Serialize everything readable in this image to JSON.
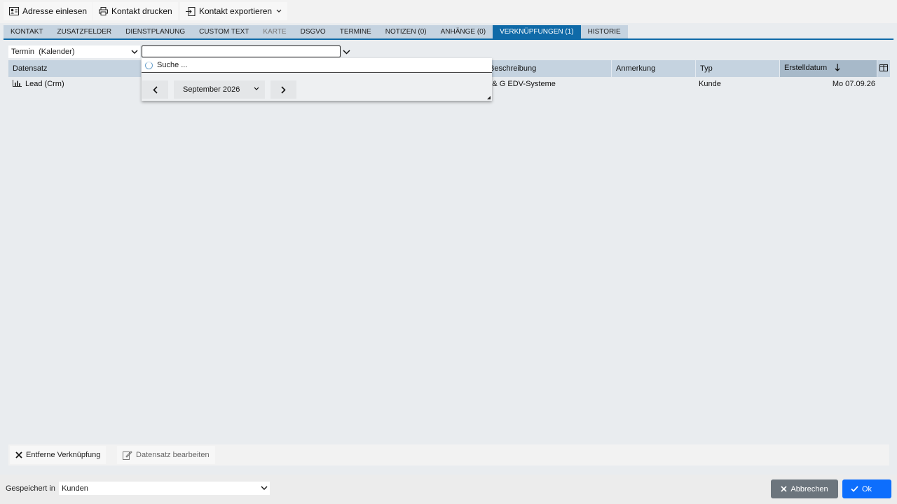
{
  "toolbar": {
    "read_address": "Adresse einlesen",
    "print_contact": "Kontakt drucken",
    "export_contact": "Kontakt exportieren"
  },
  "tabs": [
    {
      "label": "KONTAKT",
      "state": "normal"
    },
    {
      "label": "ZUSATZFELDER",
      "state": "normal"
    },
    {
      "label": "DIENSTPLANUNG",
      "state": "normal"
    },
    {
      "label": "CUSTOM TEXT",
      "state": "normal"
    },
    {
      "label": "KARTE",
      "state": "disabled"
    },
    {
      "label": "DSGVO",
      "state": "normal"
    },
    {
      "label": "TERMINE",
      "state": "normal"
    },
    {
      "label": "NOTIZEN (0)",
      "state": "normal"
    },
    {
      "label": "ANHÄNGE (0)",
      "state": "normal"
    },
    {
      "label": "VERKNÜPFUNGEN (1)",
      "state": "active"
    },
    {
      "label": "HISTORIE",
      "state": "normal"
    }
  ],
  "filter": {
    "type_value": "Termin  (Kalender)",
    "search_value": ""
  },
  "dropdown": {
    "loading_text": "Suche ...",
    "month_label": "September 2026"
  },
  "table": {
    "columns": [
      "Datensatz",
      "Beschreibung",
      "Anmerkung",
      "Typ",
      "Erstelldatum"
    ],
    "rows": [
      {
        "datensatz": "Lead (Crm)",
        "beschreibung": "B & G EDV-Systeme",
        "anmerkung": "",
        "typ": "Kunde",
        "erstelldatum": "Mo 07.09.26"
      }
    ]
  },
  "actions": {
    "remove_link": "Entferne Verknüpfung",
    "edit_record": "Datensatz bearbeiten"
  },
  "footer": {
    "saved_in_label": "Gespeichert in",
    "saved_in_value": "Kunden",
    "cancel": "Abbrechen",
    "ok": "Ok"
  },
  "colors": {
    "accent": "#0f6aa8",
    "tab_bg": "#c5d3e0",
    "cancel_bg": "#6c757d",
    "ok_bg": "#0d6efd"
  }
}
